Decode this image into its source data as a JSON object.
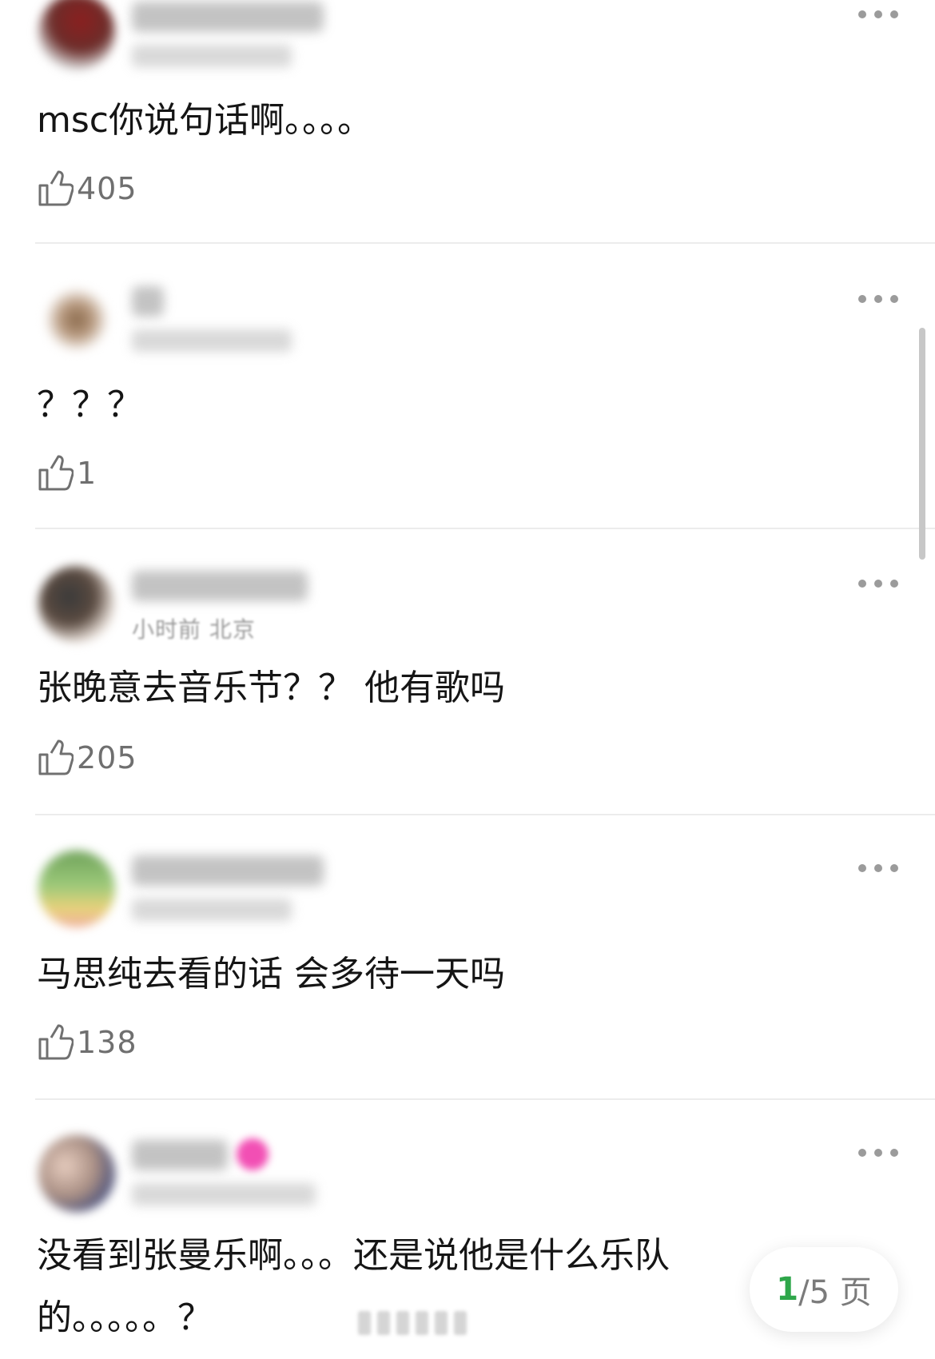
{
  "comments": [
    {
      "avatar_color": "#6b2d2a",
      "meta_text": "",
      "text": "msc你说句话啊。。。。",
      "likes": "405",
      "more_icon": "more-dots-icon",
      "like_icon": "thumbs-up-icon"
    },
    {
      "avatar_color": "#8a6a4c",
      "meta_text": "",
      "text": "？？？",
      "likes": "1",
      "more_icon": "more-dots-icon",
      "like_icon": "thumbs-up-icon"
    },
    {
      "avatar_color": "#3a3a3a",
      "meta_text": "小时前 北京",
      "text": "张晚意去音乐节？？ 他有歌吗",
      "likes": "205",
      "more_icon": "more-dots-icon",
      "like_icon": "thumbs-up-icon"
    },
    {
      "avatar_color": "#6fa25a",
      "meta_text": "",
      "text": "马思纯去看的话 会多待一天吗",
      "likes": "138",
      "more_icon": "more-dots-icon",
      "like_icon": "thumbs-up-icon"
    },
    {
      "avatar_color": "#a98f84",
      "meta_text": "",
      "text": "没看到张曼乐啊。。。还是说他是什么乐队的。。。。。？",
      "likes": "",
      "more_icon": "more-dots-icon",
      "like_icon": "thumbs-up-icon"
    }
  ],
  "pager": {
    "current": "1",
    "total_text": "/5 页"
  },
  "colors": {
    "accent": "#2ea64a",
    "text": "#151515",
    "muted": "#6f6f6f",
    "divider": "#ececec"
  }
}
